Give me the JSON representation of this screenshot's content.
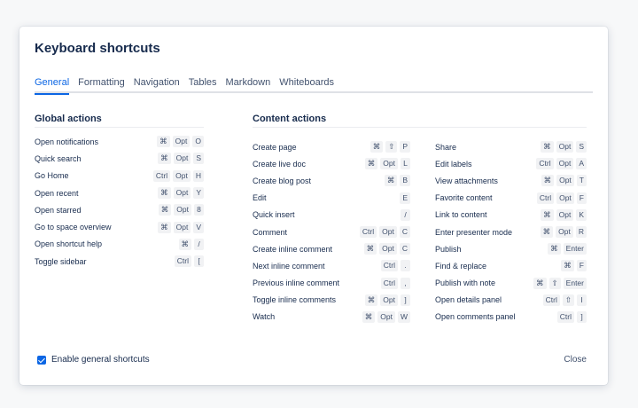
{
  "dialog": {
    "title": "Keyboard shortcuts",
    "tabs": [
      {
        "label": "General",
        "active": true
      },
      {
        "label": "Formatting",
        "active": false
      },
      {
        "label": "Navigation",
        "active": false
      },
      {
        "label": "Tables",
        "active": false
      },
      {
        "label": "Markdown",
        "active": false
      },
      {
        "label": "Whiteboards",
        "active": false
      }
    ],
    "accent_color": "#0c66e4",
    "global_actions": {
      "title": "Global actions",
      "rows": [
        {
          "label": "Open notifications",
          "keys": [
            "⌘",
            "Opt",
            "O"
          ]
        },
        {
          "label": "Quick search",
          "keys": [
            "⌘",
            "Opt",
            "S"
          ]
        },
        {
          "label": "Go Home",
          "keys": [
            "Ctrl",
            "Opt",
            "H"
          ]
        },
        {
          "label": "Open recent",
          "keys": [
            "⌘",
            "Opt",
            "Y"
          ]
        },
        {
          "label": "Open starred",
          "keys": [
            "⌘",
            "Opt",
            "8"
          ]
        },
        {
          "label": "Go to space overview",
          "keys": [
            "⌘",
            "Opt",
            "V"
          ]
        },
        {
          "label": "Open shortcut help",
          "keys": [
            "⌘",
            "/"
          ]
        },
        {
          "label": "Toggle sidebar",
          "keys": [
            "Ctrl",
            "["
          ]
        }
      ]
    },
    "content_actions": {
      "title": "Content actions",
      "left_rows": [
        {
          "label": "Create page",
          "keys": [
            "⌘",
            "⇧",
            "P"
          ]
        },
        {
          "label": "Create live doc",
          "keys": [
            "⌘",
            "Opt",
            "L"
          ]
        },
        {
          "label": "Create blog post",
          "keys": [
            "⌘",
            "B"
          ]
        },
        {
          "label": "Edit",
          "keys": [
            "E"
          ]
        },
        {
          "label": "Quick insert",
          "keys": [
            "/"
          ]
        },
        {
          "label": "Comment",
          "keys": [
            "Ctrl",
            "Opt",
            "C"
          ]
        },
        {
          "label": "Create inline comment",
          "keys": [
            "⌘",
            "Opt",
            "C"
          ]
        },
        {
          "label": "Next inline comment",
          "keys": [
            "Ctrl",
            "."
          ]
        },
        {
          "label": "Previous inline comment",
          "keys": [
            "Ctrl",
            ","
          ]
        },
        {
          "label": "Toggle inline comments",
          "keys": [
            "⌘",
            "Opt",
            "]"
          ]
        },
        {
          "label": "Watch",
          "keys": [
            "⌘",
            "Opt",
            "W"
          ]
        }
      ],
      "right_rows": [
        {
          "label": "Share",
          "keys": [
            "⌘",
            "Opt",
            "S"
          ]
        },
        {
          "label": "Edit labels",
          "keys": [
            "Ctrl",
            "Opt",
            "A"
          ]
        },
        {
          "label": "View attachments",
          "keys": [
            "⌘",
            "Opt",
            "T"
          ]
        },
        {
          "label": "Favorite content",
          "keys": [
            "Ctrl",
            "Opt",
            "F"
          ]
        },
        {
          "label": "Link to content",
          "keys": [
            "⌘",
            "Opt",
            "K"
          ]
        },
        {
          "label": "Enter presenter mode",
          "keys": [
            "⌘",
            "Opt",
            "R"
          ]
        },
        {
          "label": "Publish",
          "keys": [
            "⌘",
            "Enter"
          ]
        },
        {
          "label": "Find & replace",
          "keys": [
            "⌘",
            "F"
          ]
        },
        {
          "label": "Publish with note",
          "keys": [
            "⌘",
            "⇧",
            "Enter"
          ]
        },
        {
          "label": "Open details panel",
          "keys": [
            "Ctrl",
            "⇧",
            "I"
          ]
        },
        {
          "label": "Open comments panel",
          "keys": [
            "Ctrl",
            "]"
          ]
        }
      ]
    },
    "footer": {
      "checkbox_label": "Enable general shortcuts",
      "checkbox_checked": true,
      "close_label": "Close"
    }
  }
}
